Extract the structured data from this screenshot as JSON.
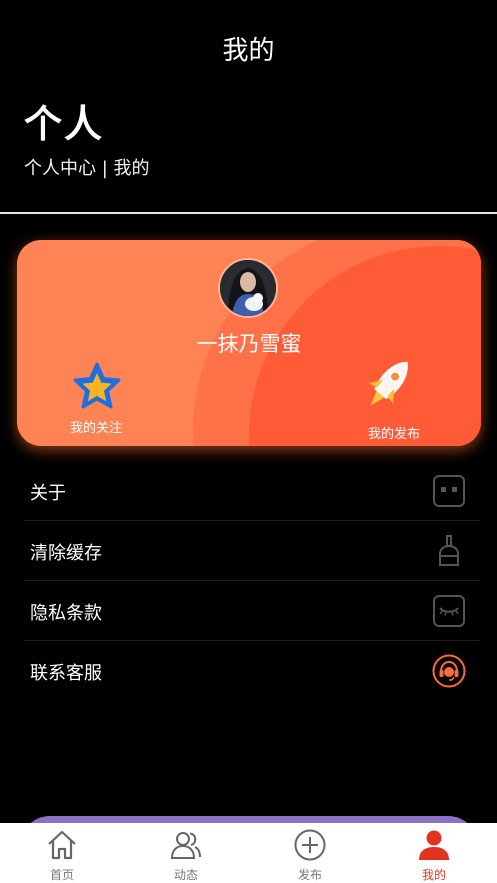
{
  "header": {
    "title": "我的"
  },
  "section": {
    "heading": "个人",
    "subheading": "个人中心 | 我的"
  },
  "profile": {
    "username": "一抹乃雪蜜",
    "follow_label": "我的关注",
    "publish_label": "我的发布"
  },
  "menu": {
    "items": [
      {
        "label": "关于",
        "icon": "about-icon"
      },
      {
        "label": "清除缓存",
        "icon": "broom-icon"
      },
      {
        "label": "隐私条款",
        "icon": "privacy-eye-icon"
      },
      {
        "label": "联系客服",
        "icon": "customer-service-icon"
      }
    ]
  },
  "tabbar": {
    "tabs": [
      {
        "label": "首页",
        "icon": "home-icon"
      },
      {
        "label": "动态",
        "icon": "users-icon"
      },
      {
        "label": "发布",
        "icon": "plus-circle-icon"
      },
      {
        "label": "我的",
        "icon": "person-icon",
        "active": true
      }
    ]
  },
  "colors": {
    "card_base": "#ff8354",
    "card_accent": "#ff5b37",
    "tab_active": "#e23320",
    "tab_inactive": "#777777"
  }
}
